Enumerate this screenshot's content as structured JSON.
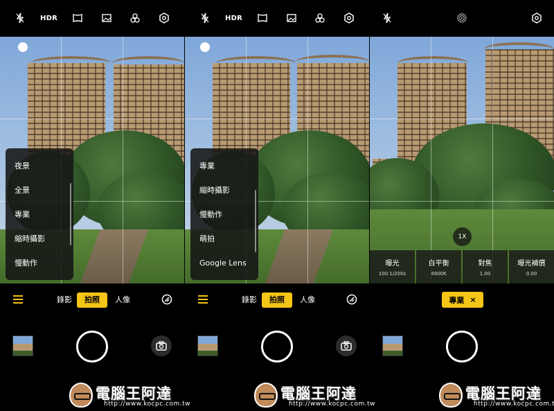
{
  "panels": [
    {
      "topbar": [
        "flash-off-icon",
        "HDR",
        "panorama-icon",
        "photo-icon",
        "filter-icon",
        "settings-icon"
      ],
      "menu": [
        "夜景",
        "全景",
        "專業",
        "縮時攝影",
        "慢動作"
      ],
      "modes": [
        "錄影",
        "拍照",
        "人像"
      ],
      "active_mode": "拍照"
    },
    {
      "topbar": [
        "flash-off-icon",
        "HDR",
        "panorama-icon",
        "photo-icon",
        "filter-icon",
        "settings-icon"
      ],
      "menu": [
        "專業",
        "縮時攝影",
        "慢動作",
        "萌拍",
        "Google Lens"
      ],
      "modes": [
        "錄影",
        "拍照",
        "人像"
      ],
      "active_mode": "拍照"
    },
    {
      "topbar": [
        "flash-off-icon",
        "metering-icon",
        "settings-icon"
      ],
      "zoom": "1X",
      "pro": [
        {
          "label": "曝光",
          "value": "100  1/200s"
        },
        {
          "label": "白平衡",
          "value": "4900K"
        },
        {
          "label": "對焦",
          "value": "1.00"
        },
        {
          "label": "曝光補償",
          "value": "0.00"
        }
      ],
      "chip_label": "專業",
      "chip_close": "×"
    }
  ],
  "hdr_label": "HDR",
  "watermark": {
    "title": "電腦王阿達",
    "url": "http://www.kocpc.com.tw"
  },
  "colors": {
    "accent": "#f5c518",
    "background": "#000000",
    "menu_bg": "#161616"
  }
}
